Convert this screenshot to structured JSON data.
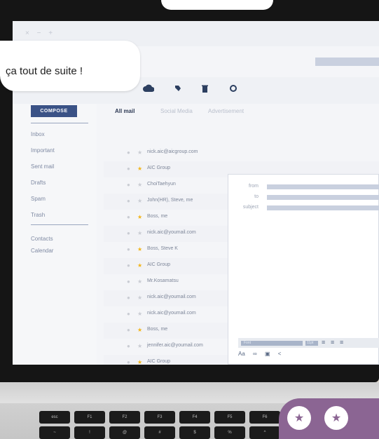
{
  "overlay": {
    "bubble_text": "ça tout de suite !"
  },
  "window": {
    "controls": "× − +"
  },
  "toolbar": {
    "icons": [
      "cloud-icon",
      "tag-icon",
      "trash-icon",
      "settings-icon"
    ]
  },
  "sidebar": {
    "compose_label": "COMPOSE",
    "items": [
      {
        "label": "Inbox"
      },
      {
        "label": "Important"
      },
      {
        "label": "Sent mail"
      },
      {
        "label": "Drafts"
      },
      {
        "label": "Spam"
      },
      {
        "label": "Trash"
      }
    ],
    "extra_items": [
      {
        "label": "Contacts"
      },
      {
        "label": "Calendar"
      }
    ]
  },
  "tabs": [
    {
      "label": "All mail",
      "active": true
    },
    {
      "label": "Social Media",
      "active": false
    },
    {
      "label": "Advertisement",
      "active": false
    }
  ],
  "messages": [
    {
      "sender": "nick.aic@aicgroup.com",
      "starred": false
    },
    {
      "sender": "AIC Group",
      "starred": true
    },
    {
      "sender": "ChoiTaehyun",
      "starred": false
    },
    {
      "sender": "John(HR), Steve, me",
      "starred": false
    },
    {
      "sender": "Boss, me",
      "starred": true
    },
    {
      "sender": "nick.aic@youmail.com",
      "starred": false
    },
    {
      "sender": "Boss, Steve K",
      "starred": true
    },
    {
      "sender": "AIC Group",
      "starred": true
    },
    {
      "sender": "Mr.Kosamatsu",
      "starred": false
    },
    {
      "sender": "nick.aic@youmail.com",
      "starred": false
    },
    {
      "sender": "nick.aic@youmail.com",
      "starred": false
    },
    {
      "sender": "Boss, me",
      "starred": true
    },
    {
      "sender": "jennifer.aic@youmail.com",
      "starred": false
    },
    {
      "sender": "AIC Group",
      "starred": true
    }
  ],
  "compose": {
    "from_label": "from",
    "to_label": "to",
    "subject_label": "subject",
    "font_label": "Font",
    "size_label": "11pt",
    "bottom_icons": "Aa",
    "bottom_icon_names": [
      "link-icon",
      "image-icon",
      "share-icon"
    ]
  },
  "keyboard": {
    "keys": [
      "esc",
      "F1",
      "F2",
      "F3",
      "F4",
      "F5",
      "F6"
    ],
    "row2": [
      "~",
      "!",
      "@",
      "#",
      "$",
      "%",
      "^"
    ]
  },
  "rating": {
    "count": 2,
    "icon": "star-icon"
  },
  "colors": {
    "compose_btn": "#3a5286",
    "star": "#f2b51a",
    "rating_bg": "#8b6593"
  }
}
